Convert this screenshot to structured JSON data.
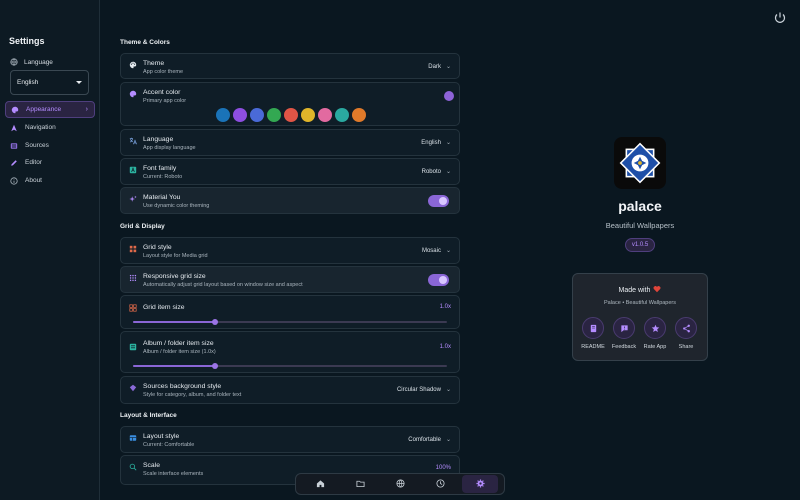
{
  "sidebar": {
    "title": "Settings",
    "language_label": "Language",
    "language_value": "English",
    "items": [
      {
        "label": "Appearance",
        "icon": "palette-icon",
        "active": true
      },
      {
        "label": "Navigation",
        "icon": "navigation-icon"
      },
      {
        "label": "Sources",
        "icon": "sources-icon"
      },
      {
        "label": "Editor",
        "icon": "pencil-icon"
      },
      {
        "label": "About",
        "icon": "info-icon"
      }
    ]
  },
  "sections": {
    "theme": "Theme & Colors",
    "grid": "Grid & Display",
    "layout": "Layout & Interface"
  },
  "settings": {
    "theme": {
      "title": "Theme",
      "subtitle": "App color theme",
      "value": "Dark"
    },
    "accent": {
      "title": "Accent color",
      "subtitle": "Primary app color"
    },
    "language": {
      "title": "Language",
      "subtitle": "App display language",
      "value": "English"
    },
    "font": {
      "title": "Font family",
      "subtitle": "Current: Roboto",
      "value": "Roboto"
    },
    "material": {
      "title": "Material You",
      "subtitle": "Use dynamic color theming",
      "enabled": true
    },
    "grid_style": {
      "title": "Grid style",
      "subtitle": "Layout style for Media grid",
      "value": "Mosaic"
    },
    "responsive": {
      "title": "Responsive grid size",
      "subtitle": "Automatically adjust grid layout based on window size and aspect",
      "enabled": true
    },
    "grid_size": {
      "title": "Grid item size",
      "value": "1.0x",
      "level": 0.26
    },
    "album_size": {
      "title": "Album / folder item size",
      "subtitle": "Album / folder item size (1.0x)",
      "value": "1.0x",
      "level": 0.26
    },
    "sources_bg": {
      "title": "Sources background style",
      "subtitle": "Style for category, album, and folder text",
      "value": "Circular Shadow"
    },
    "layout_style": {
      "title": "Layout style",
      "subtitle": "Current: Comfortable",
      "value": "Comfortable"
    },
    "scale": {
      "title": "Scale",
      "subtitle": "Scale interface elements",
      "value": "100%"
    }
  },
  "accent_colors": [
    "#1a73b8",
    "#8d4ee0",
    "#4a6ad8",
    "#33a852",
    "#e05546",
    "#e0b52a",
    "#e26aa0",
    "#2aa8a0",
    "#e07a2a"
  ],
  "selected_accent": "#8d63d8",
  "about": {
    "app_name": "palace",
    "tagline": "Beautiful Wallpapers",
    "version": "v1.0.5",
    "made_with": "Made with",
    "made_sub": "Palace • Beautiful Wallpapers",
    "actions": [
      "README",
      "Feedback",
      "Rate App",
      "Share"
    ]
  },
  "bottom_nav": [
    "home-icon",
    "folder-icon",
    "globe-icon",
    "history-icon",
    "settings-icon"
  ],
  "colors": {
    "accent": "#b48cff",
    "background": "#0a1720"
  }
}
